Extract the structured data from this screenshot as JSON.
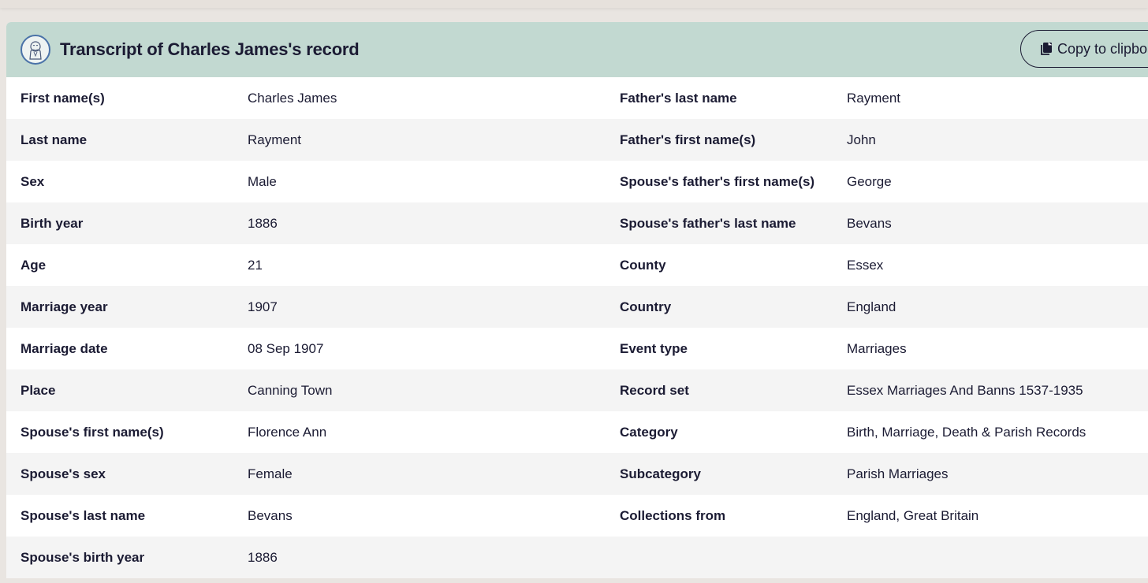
{
  "header": {
    "title": "Transcript of Charles James's record",
    "copy_label": "Copy to clipboard",
    "avatar_icon": "person-sketch-icon",
    "copy_icon": "copy-document-icon",
    "header_bg": "#c2d9d1"
  },
  "rows": [
    {
      "l1": "First name(s)",
      "v1": "Charles James",
      "l2": "Father's last name",
      "v2": "Rayment"
    },
    {
      "l1": "Last name",
      "v1": "Rayment",
      "l2": "Father's first name(s)",
      "v2": "John"
    },
    {
      "l1": "Sex",
      "v1": "Male",
      "l2": "Spouse's father's first name(s)",
      "v2": "George"
    },
    {
      "l1": "Birth year",
      "v1": "1886",
      "l2": "Spouse's father's last name",
      "v2": "Bevans"
    },
    {
      "l1": "Age",
      "v1": "21",
      "l2": "County",
      "v2": "Essex"
    },
    {
      "l1": "Marriage year",
      "v1": "1907",
      "l2": "Country",
      "v2": "England"
    },
    {
      "l1": "Marriage date",
      "v1": "08 Sep 1907",
      "l2": "Event type",
      "v2": "Marriages"
    },
    {
      "l1": "Place",
      "v1": "Canning Town",
      "l2": "Record set",
      "v2": "Essex Marriages And Banns 1537-1935"
    },
    {
      "l1": "Spouse's first name(s)",
      "v1": "Florence Ann",
      "l2": "Category",
      "v2": "Birth, Marriage, Death & Parish Records"
    },
    {
      "l1": "Spouse's sex",
      "v1": "Female",
      "l2": "Subcategory",
      "v2": "Parish Marriages"
    },
    {
      "l1": "Spouse's last name",
      "v1": "Bevans",
      "l2": "Collections from",
      "v2": "England, Great Britain"
    },
    {
      "l1": "Spouse's birth year",
      "v1": "1886",
      "l2": "",
      "v2": ""
    }
  ]
}
